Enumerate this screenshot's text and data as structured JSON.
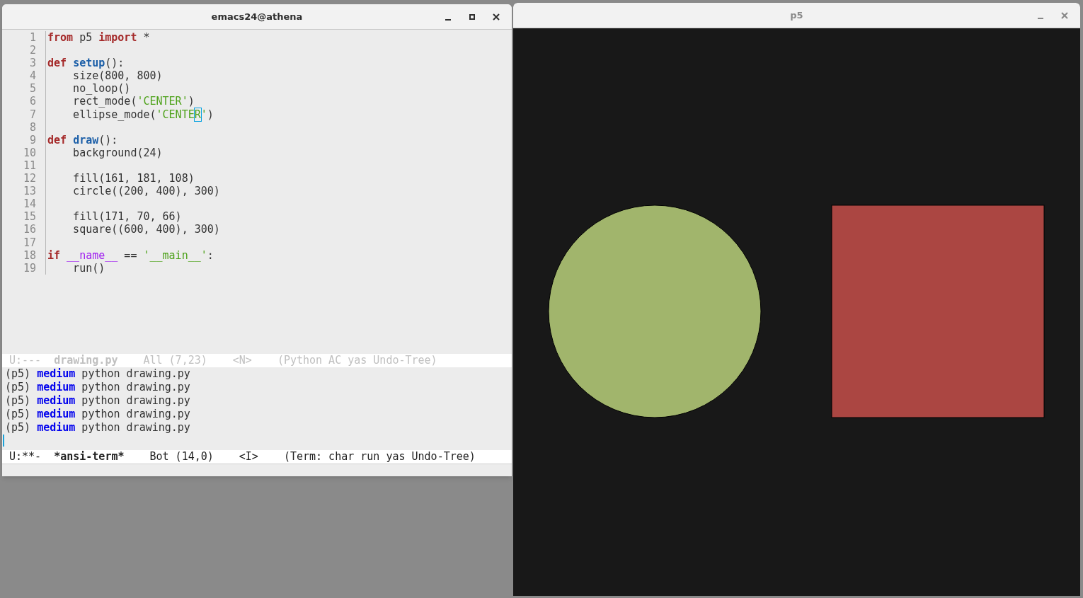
{
  "editor_window": {
    "title": "emacs24@athena",
    "code_lines": [
      {
        "number": "1",
        "tokens": [
          {
            "kind": "keyword",
            "text": "from"
          },
          {
            "kind": "plain",
            "text": " p5 "
          },
          {
            "kind": "keyword",
            "text": "import"
          },
          {
            "kind": "plain",
            "text": " *"
          }
        ]
      },
      {
        "number": "2"
      },
      {
        "number": "3",
        "tokens": [
          {
            "kind": "keyword",
            "text": "def "
          },
          {
            "kind": "function",
            "text": "setup"
          },
          {
            "kind": "plain",
            "text": "():"
          }
        ]
      },
      {
        "number": "4",
        "tokens": [
          {
            "kind": "plain",
            "text": "    size(800, 800)"
          }
        ]
      },
      {
        "number": "5",
        "tokens": [
          {
            "kind": "plain",
            "text": "    no_loop()"
          }
        ]
      },
      {
        "number": "6",
        "tokens": [
          {
            "kind": "plain",
            "text": "    rect_mode("
          },
          {
            "kind": "string",
            "text": "'CENTER'"
          },
          {
            "kind": "plain",
            "text": ")"
          }
        ]
      },
      {
        "number": "7",
        "tokens": [
          {
            "kind": "plain",
            "text": "    ellipse_mode("
          },
          {
            "kind": "string",
            "text": "'CENTE"
          },
          {
            "kind": "cursor",
            "text": "R"
          },
          {
            "kind": "string",
            "text": "'"
          },
          {
            "kind": "plain",
            "text": ")"
          }
        ]
      },
      {
        "number": "8"
      },
      {
        "number": "9",
        "tokens": [
          {
            "kind": "keyword",
            "text": "def "
          },
          {
            "kind": "function",
            "text": "draw"
          },
          {
            "kind": "plain",
            "text": "():"
          }
        ]
      },
      {
        "number": "10",
        "tokens": [
          {
            "kind": "plain",
            "text": "    background(24)"
          }
        ]
      },
      {
        "number": "11"
      },
      {
        "number": "12",
        "tokens": [
          {
            "kind": "plain",
            "text": "    fill(161, 181, 108)"
          }
        ]
      },
      {
        "number": "13",
        "tokens": [
          {
            "kind": "plain",
            "text": "    circle((200, 400), 300)"
          }
        ]
      },
      {
        "number": "14"
      },
      {
        "number": "15",
        "tokens": [
          {
            "kind": "plain",
            "text": "    fill(171, 70, 66)"
          }
        ]
      },
      {
        "number": "16",
        "tokens": [
          {
            "kind": "plain",
            "text": "    square((600, 400), 300)"
          }
        ]
      },
      {
        "number": "17"
      },
      {
        "number": "18",
        "tokens": [
          {
            "kind": "keyword",
            "text": "if "
          },
          {
            "kind": "builtin",
            "text": "__name__"
          },
          {
            "kind": "plain",
            "text": " == "
          },
          {
            "kind": "string",
            "text": "'__main__'"
          },
          {
            "kind": "plain",
            "text": ":"
          }
        ]
      },
      {
        "number": "19",
        "tokens": [
          {
            "kind": "plain",
            "text": "    run()"
          }
        ]
      }
    ],
    "editor_mode_line": {
      "active": false,
      "parts": [
        {
          "text": "U:---",
          "bold": false
        },
        {
          "text": "drawing.py",
          "bold": true
        },
        {
          "text": "All (7,23)",
          "bold": false
        },
        {
          "text": "<N>",
          "bold": false
        },
        {
          "text": "(Python AC yas Undo-Tree)",
          "bold": false
        }
      ]
    },
    "terminal_lines": [
      [
        {
          "kind": "plain",
          "text": "(p5) "
        },
        {
          "kind": "prompt",
          "text": "medium"
        },
        {
          "kind": "plain",
          "text": " python drawing.py"
        }
      ],
      [
        {
          "kind": "plain",
          "text": "(p5) "
        },
        {
          "kind": "prompt",
          "text": "medium"
        },
        {
          "kind": "plain",
          "text": " python drawing.py"
        }
      ],
      [
        {
          "kind": "plain",
          "text": "(p5) "
        },
        {
          "kind": "prompt",
          "text": "medium"
        },
        {
          "kind": "plain",
          "text": " python drawing.py"
        }
      ],
      [
        {
          "kind": "plain",
          "text": "(p5) "
        },
        {
          "kind": "prompt",
          "text": "medium"
        },
        {
          "kind": "plain",
          "text": " python drawing.py"
        }
      ],
      [
        {
          "kind": "plain",
          "text": "(p5) "
        },
        {
          "kind": "prompt",
          "text": "medium"
        },
        {
          "kind": "plain",
          "text": " python drawing.py"
        }
      ]
    ],
    "terminal_mode_line": {
      "active": true,
      "parts": [
        {
          "text": "U:**-",
          "bold": false
        },
        {
          "text": "*ansi-term*",
          "bold": true
        },
        {
          "text": "Bot (14,0)",
          "bold": false
        },
        {
          "text": "<I>",
          "bold": false
        },
        {
          "text": "(Term: char run yas Undo-Tree)",
          "bold": false
        }
      ]
    }
  },
  "sketch_window": {
    "title": "p5"
  }
}
